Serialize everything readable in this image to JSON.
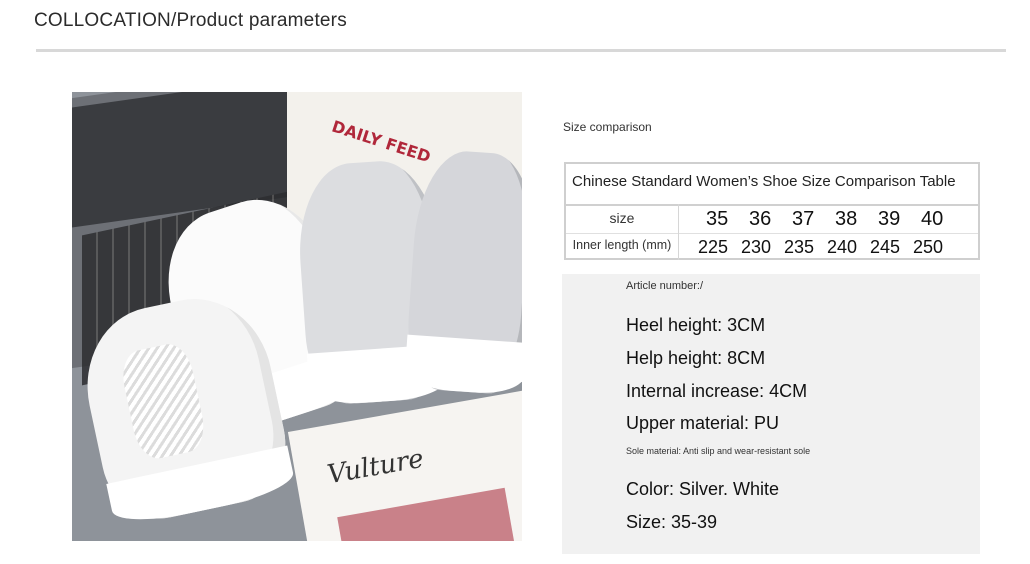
{
  "header": {
    "title": "COLLOCATION/Product parameters"
  },
  "photo": {
    "bag_text": "DAILY FEED",
    "magazine_word": "Vulture"
  },
  "size_section": {
    "caption": "Size comparison",
    "table_title": "Chinese Standard Women’s Shoe Size Comparison Table",
    "row1_label": "size",
    "row2_label": "Inner length (mm)",
    "sizes": [
      "35",
      "36",
      "37",
      "38",
      "39",
      "40"
    ],
    "inner_lengths": [
      "225",
      "230",
      "235",
      "240",
      "245",
      "250"
    ]
  },
  "params": {
    "article": "Article number:/",
    "heel": "Heel height: 3CM",
    "help": "Help height: 8CM",
    "increase": "Internal increase: 4CM",
    "upper": "Upper material: PU",
    "sole": "Sole material: Anti slip and wear-resistant sole",
    "color": "Color: Silver. White",
    "size": "Size: 35-39"
  }
}
